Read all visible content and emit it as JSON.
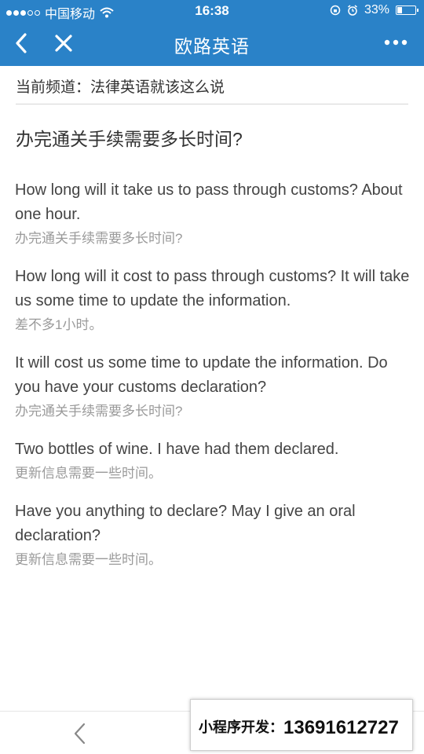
{
  "status_bar": {
    "carrier": "中国移动",
    "time": "16:38",
    "battery": "33%",
    "battery_level": 0.33,
    "icons": [
      "signal-icon",
      "wifi-icon",
      "lock-rotation-icon",
      "alarm-icon",
      "battery-icon"
    ]
  },
  "nav": {
    "title": "欧路英语",
    "icons": [
      "back-icon",
      "close-icon",
      "more-icon"
    ]
  },
  "channel": {
    "text": "当前频道：法律英语就该这么说"
  },
  "headline": "办完通关手续需要多长时间?",
  "entries": [
    {
      "en": "How long will it take us to pass through customs? About one hour.",
      "zh": "办完通关手续需要多长时间?"
    },
    {
      "en": "How long will it cost to pass through customs? It will take us some time to update the information.",
      "zh": "差不多1小时。"
    },
    {
      "en": "It will cost us some time to update the information. Do you have your customs declaration?",
      "zh": "办完通关手续需要多长时间?"
    },
    {
      "en": "Two bottles of wine. I have had them declared.",
      "zh": "更新信息需要一些时间。"
    },
    {
      "en": "Have you anything to declare? May I give an oral declaration?",
      "zh": "更新信息需要一些时间。"
    }
  ],
  "ad": {
    "label": "小程序开发：",
    "phone": "13691612727"
  },
  "colors": {
    "header_blue": "#2a82c8",
    "text_dark": "#444444",
    "text_gray": "#9a9a9a"
  }
}
